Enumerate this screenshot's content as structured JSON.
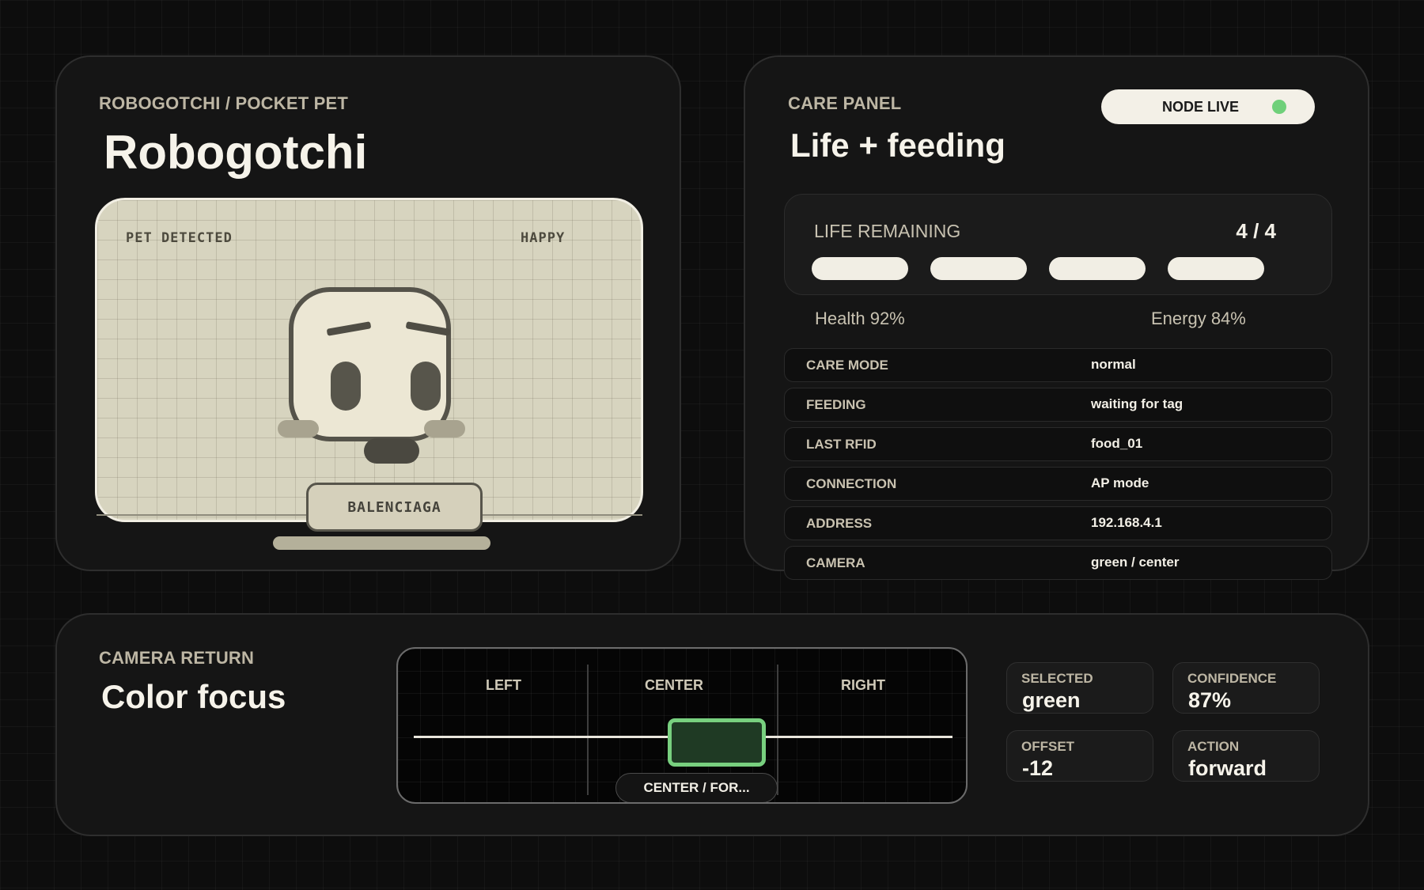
{
  "pet": {
    "eyebrow": "ROBOGOTCHI / POCKET PET",
    "title": "Robogotchi",
    "screen": {
      "status": "PET DETECTED",
      "mood": "HAPPY"
    },
    "nameplate": "BALENCIAGA"
  },
  "care": {
    "eyebrow": "CARE PANEL",
    "title": "Life + feeding",
    "status_pill": {
      "label": "NODE LIVE",
      "indicator_color": "#6fd07a"
    },
    "life": {
      "label": "LIFE REMAINING",
      "count": "4 / 4",
      "hearts_filled": 4,
      "hearts_total": 4
    },
    "health": "Health 92%",
    "energy": "Energy 84%",
    "rows": [
      {
        "key": "CARE MODE",
        "value": "normal"
      },
      {
        "key": "FEEDING",
        "value": "waiting for tag"
      },
      {
        "key": "LAST RFID",
        "value": "food_01"
      },
      {
        "key": "CONNECTION",
        "value": "AP mode"
      },
      {
        "key": "ADDRESS",
        "value": "192.168.4.1"
      },
      {
        "key": "CAMERA",
        "value": "green / center"
      }
    ]
  },
  "camera": {
    "eyebrow": "CAMERA RETURN",
    "title": "Color focus",
    "zones": [
      "LEFT",
      "CENTER",
      "RIGHT"
    ],
    "chip": "CENTER / FOR...",
    "target_color": "#78d07f",
    "metrics": {
      "selected": {
        "label": "SELECTED",
        "value": "green"
      },
      "confidence": {
        "label": "CONFIDENCE",
        "value": "87%"
      },
      "offset": {
        "label": "OFFSET",
        "value": "-12"
      },
      "action": {
        "label": "ACTION",
        "value": "forward"
      }
    }
  },
  "colors": {
    "background": "#0d0d0d",
    "card": "#151515",
    "screen": "#d7d4bf",
    "accent_green": "#6fd07a"
  }
}
